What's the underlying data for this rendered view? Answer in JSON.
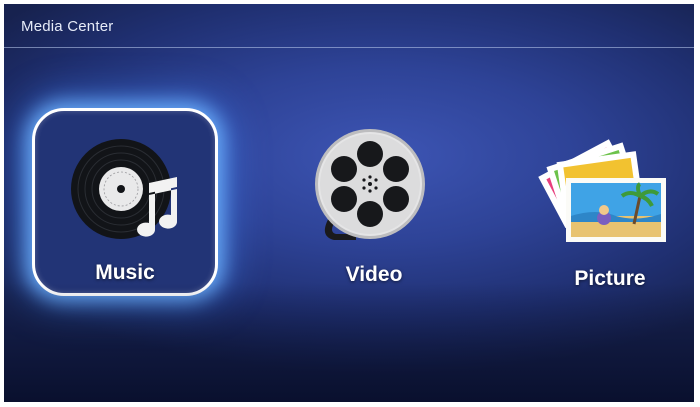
{
  "header": {
    "title": "Media Center"
  },
  "tiles": [
    {
      "label": "Music",
      "icon": "vinyl-record-note-icon",
      "focused": true
    },
    {
      "label": "Video",
      "icon": "film-reel-icon",
      "focused": false
    },
    {
      "label": "Picture",
      "icon": "photo-stack-icon",
      "focused": false
    }
  ],
  "colors": {
    "background": "#2e4397",
    "focus_glow": "#6eb4ff",
    "text": "#ffffff"
  }
}
